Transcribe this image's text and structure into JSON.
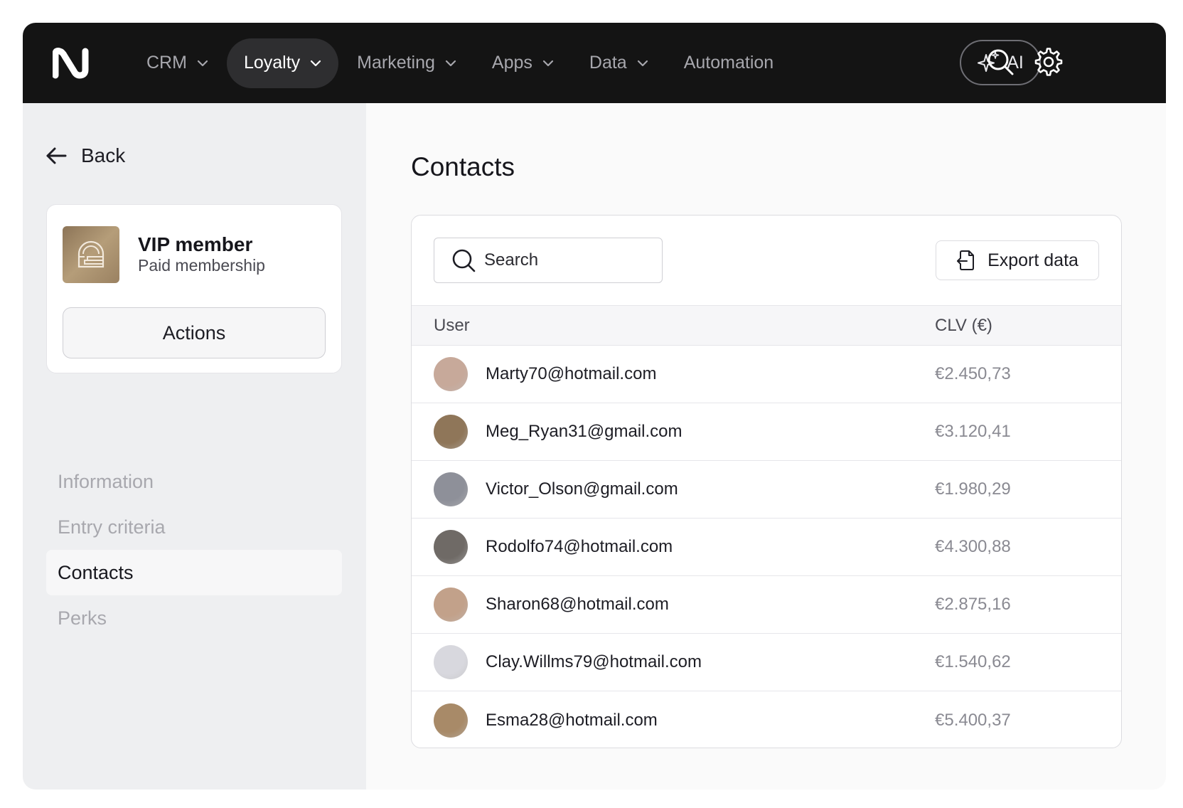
{
  "nav": {
    "items": [
      {
        "label": "CRM",
        "dropdown": true,
        "active": false
      },
      {
        "label": "Loyalty",
        "dropdown": true,
        "active": true
      },
      {
        "label": "Marketing",
        "dropdown": true,
        "active": false
      },
      {
        "label": "Apps",
        "dropdown": true,
        "active": false
      },
      {
        "label": "Data",
        "dropdown": true,
        "active": false
      },
      {
        "label": "Automation",
        "dropdown": false,
        "active": false
      }
    ],
    "ai_label": "AI"
  },
  "sidebar": {
    "back_label": "Back",
    "member": {
      "title": "VIP member",
      "subtitle": "Paid membership",
      "actions_label": "Actions"
    },
    "items": [
      {
        "label": "Information",
        "active": false
      },
      {
        "label": "Entry criteria",
        "active": false
      },
      {
        "label": "Contacts",
        "active": true
      },
      {
        "label": "Perks",
        "active": false
      }
    ]
  },
  "main": {
    "title": "Contacts",
    "search_placeholder": "Search",
    "export_label": "Export data",
    "columns": {
      "user": "User",
      "clv": "CLV (€)"
    },
    "rows": [
      {
        "email": "Marty70@hotmail.com",
        "clv": "€2.450,73",
        "avatar_color": "#c7a99a"
      },
      {
        "email": "Meg_Ryan31@gmail.com",
        "clv": "€3.120,41",
        "avatar_color": "#8f7659"
      },
      {
        "email": "Victor_Olson@gmail.com",
        "clv": "€1.980,29",
        "avatar_color": "#8e9099"
      },
      {
        "email": "Rodolfo74@hotmail.com",
        "clv": "€4.300,88",
        "avatar_color": "#6f6a66"
      },
      {
        "email": "Sharon68@hotmail.com",
        "clv": "€2.875,16",
        "avatar_color": "#c2a18a"
      },
      {
        "email": "Clay.Willms79@hotmail.com",
        "clv": "€1.540,62",
        "avatar_color": "#d8d8de"
      },
      {
        "email": "Esma28@hotmail.com",
        "clv": "€5.400,37",
        "avatar_color": "#a88a68"
      }
    ]
  },
  "colors": {
    "topbar": "#141414",
    "sidebar": "#eeeff1",
    "active_nav": "#2e2e30",
    "member_gold": "#a78d6b"
  },
  "icons": {
    "logo": "brand-n-logo",
    "ai": "sparkle-icon",
    "search": "search-icon",
    "settings": "gear-icon",
    "back": "arrow-left-icon",
    "export": "export-file-icon"
  }
}
